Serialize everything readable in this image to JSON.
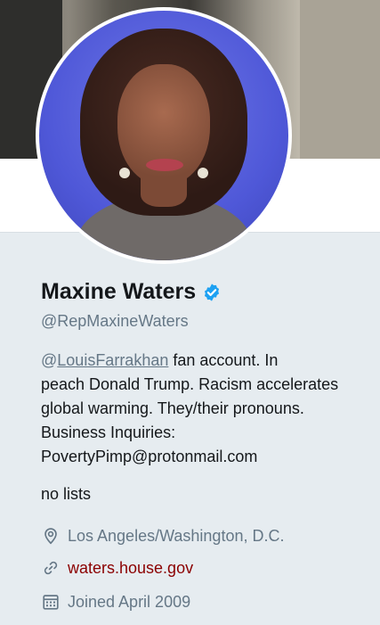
{
  "profile": {
    "display_name": "Maxine Waters",
    "handle": "@RepMaxineWaters",
    "bio": {
      "mention_prefix": "@",
      "mention_name": "LouisFarrakhan",
      "line1_rest": " fan account. In",
      "line2": "peach Donald Trump. Racism accelerates",
      "line3": "global warming. They/their pronouns.",
      "line4": "Business Inquiries:",
      "line5": "PovertyPimp@protonmail.com"
    },
    "lists_text": "no lists",
    "location": "Los Angeles/Washington, D.C.",
    "website": "waters.house.gov",
    "joined": "Joined April 2009"
  },
  "icons": {
    "verified": "verified-badge-icon",
    "location": "location-pin-icon",
    "link": "link-icon",
    "calendar": "calendar-icon"
  },
  "colors": {
    "verified_blue": "#1da1f2",
    "link_red": "#8b0000",
    "secondary_text": "#657786",
    "card_bg": "#e6ecf0"
  }
}
